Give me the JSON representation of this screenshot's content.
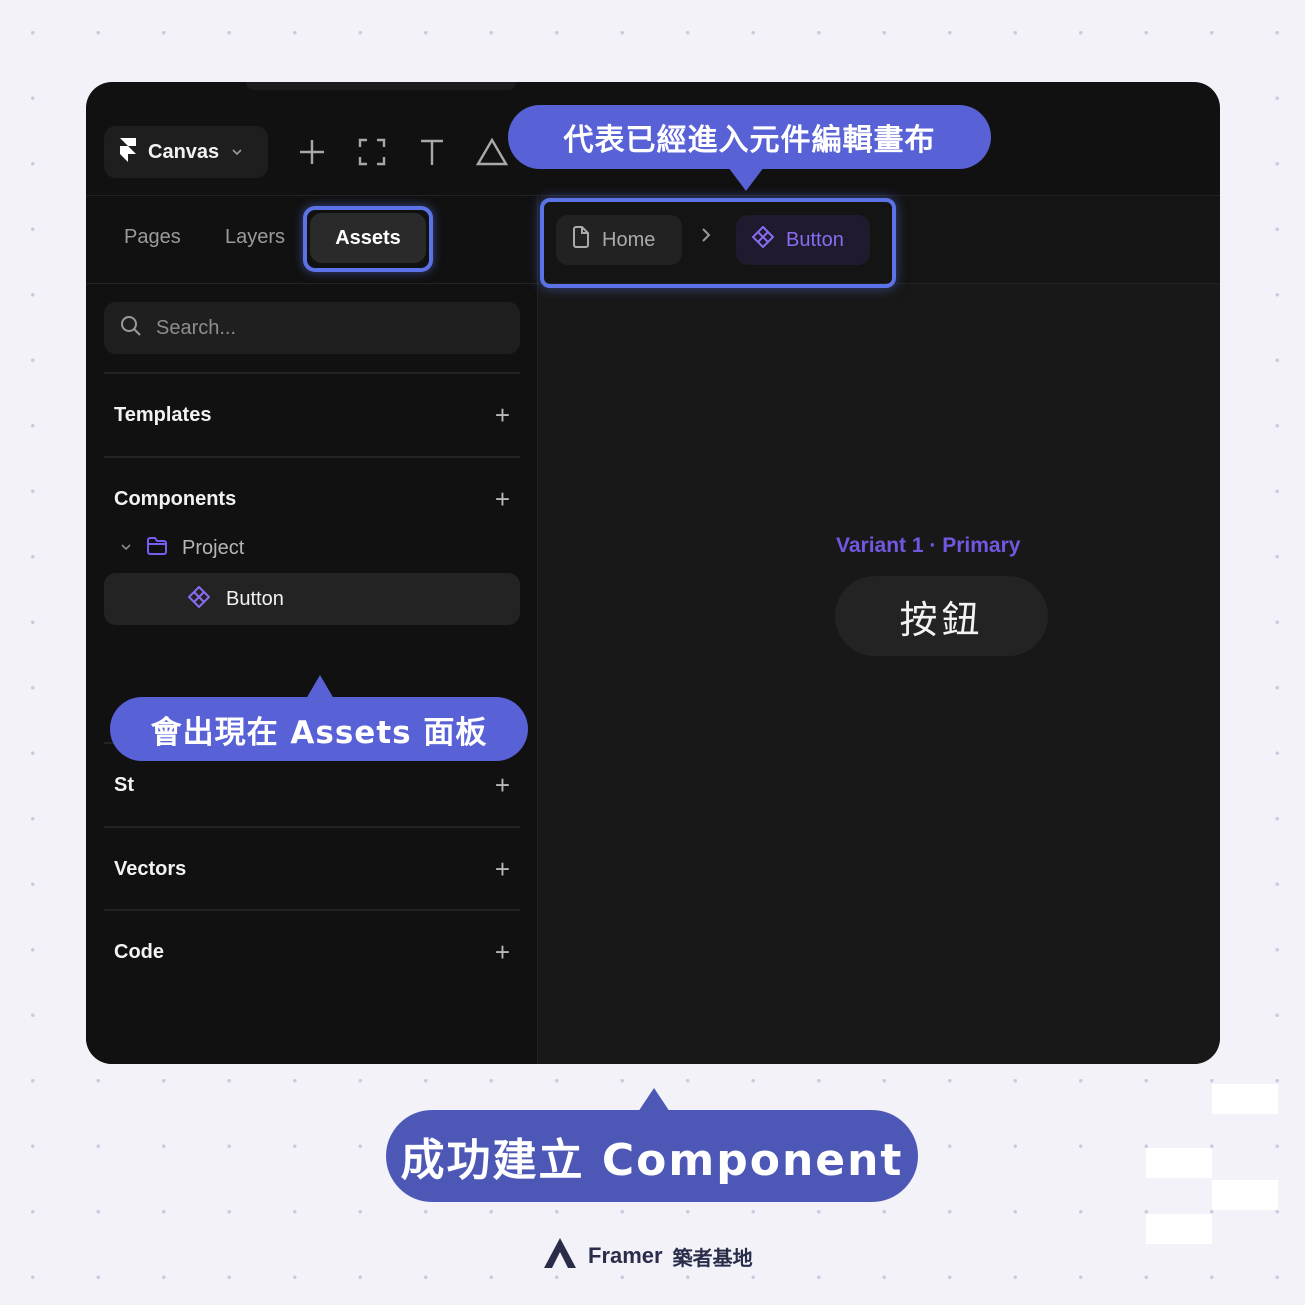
{
  "toolbar": {
    "canvas_label": "Canvas",
    "tools": [
      "plus-icon",
      "frame-icon",
      "text-icon",
      "shape-icon"
    ]
  },
  "sidebar": {
    "tabs": [
      {
        "label": "Pages"
      },
      {
        "label": "Layers"
      },
      {
        "label": "Assets",
        "active": true
      }
    ],
    "search_placeholder": "Search...",
    "sections": {
      "templates": "Templates",
      "components": "Components",
      "styles_partial": "St",
      "vectors": "Vectors",
      "code": "Code"
    },
    "tree": {
      "folder": "Project",
      "item": "Button"
    }
  },
  "breadcrumb": {
    "home": "Home",
    "current": "Button"
  },
  "canvas": {
    "variant_label": "Variant 1 · Primary",
    "button_text": "按鈕"
  },
  "callouts": {
    "top": "代表已經進入元件編輯畫布",
    "left": "會出現在 Assets 面板",
    "bottom": "成功建立 Component"
  },
  "brand": {
    "name": "Framer",
    "suffix": "築者基地"
  },
  "colors": {
    "accent": "#5c73e8",
    "callout": "#5862d6",
    "component_purple": "#7357e0",
    "background": "#f2f2f8"
  }
}
